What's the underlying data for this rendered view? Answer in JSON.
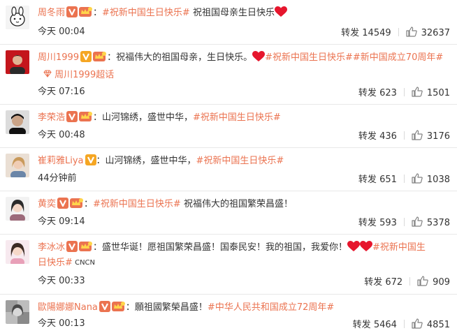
{
  "colors": {
    "accent": "#eb7350",
    "heart": "#e6162d",
    "vip_gold": "#f5a623"
  },
  "comments": [
    {
      "user": "周冬雨",
      "segments": [
        {
          "t": "：",
          "k": "txt"
        },
        {
          "t": "#祝新中国生日快乐#",
          "k": "tag"
        },
        {
          "t": " 祝祖国母亲生日快乐",
          "k": "txt"
        }
      ],
      "time": "今天 00:04",
      "forward_label": "转发",
      "forward_count": "14549",
      "likes": "32637"
    },
    {
      "user": "周川1999",
      "segments": [
        {
          "t": "：祝福伟大的祖国母亲，生日快乐。",
          "k": "txt"
        },
        {
          "t": "#祝新中国生日快乐#",
          "k": "tag"
        },
        {
          "t": "#新中国成立70周年#",
          "k": "tag"
        }
      ],
      "supertopic": "周川1999超话",
      "time": "今天 07:16",
      "forward_label": "转发",
      "forward_count": "623",
      "likes": "1501"
    },
    {
      "user": "李荣浩",
      "segments": [
        {
          "t": "：山河锦绣，盛世中华，",
          "k": "txt"
        },
        {
          "t": "#祝新中国生日快乐#",
          "k": "tag"
        }
      ],
      "time": "今天 00:48",
      "forward_label": "转发",
      "forward_count": "436",
      "likes": "3176"
    },
    {
      "user": "崔莉雅Liya",
      "segments": [
        {
          "t": "：山河锦绣，盛世中华，",
          "k": "txt"
        },
        {
          "t": "#祝新中国生日快乐#",
          "k": "tag"
        }
      ],
      "time": "44分钟前",
      "forward_label": "转发",
      "forward_count": "651",
      "likes": "1038"
    },
    {
      "user": "黄奕",
      "segments": [
        {
          "t": "：",
          "k": "txt"
        },
        {
          "t": "#祝新中国生日快乐#",
          "k": "tag"
        },
        {
          "t": " 祝福伟大的祖国繁荣昌盛！",
          "k": "txt"
        }
      ],
      "time": "今天 09:14",
      "forward_label": "转发",
      "forward_count": "593",
      "likes": "5378"
    },
    {
      "user": "李冰冰",
      "segments": [
        {
          "t": "：盛世华诞！愿祖国繁荣昌盛！国泰民安！我的祖国，我爱你！",
          "k": "txt"
        }
      ],
      "segments_after_hearts": [
        {
          "t": "#祝新中国生",
          "k": "tag"
        }
      ],
      "line2": [
        {
          "t": "日快乐#",
          "k": "tag"
        },
        {
          "t": " CNCN",
          "k": "small"
        }
      ],
      "time": "今天 00:33",
      "forward_label": "转发",
      "forward_count": "672",
      "likes": "909"
    },
    {
      "user": "歐陽娜娜Nana",
      "segments": [
        {
          "t": "：願祖國繁榮昌盛！",
          "k": "txt"
        },
        {
          "t": "#中华人民共和国成立72周年#",
          "k": "tag"
        }
      ],
      "time": "今天 00:13",
      "forward_label": "转发",
      "forward_count": "5464",
      "likes": "4851"
    }
  ]
}
